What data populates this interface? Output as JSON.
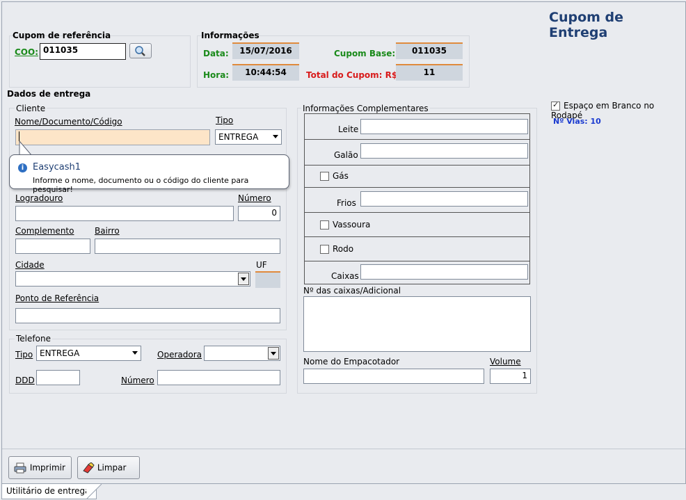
{
  "title": "Cupom de Entrega",
  "cupom_ref": {
    "heading": "Cupom de referência",
    "coo_label": "COO:",
    "coo_value": "011035"
  },
  "info": {
    "heading": "Informações",
    "data_label": "Data:",
    "data_value": "15/07/2016",
    "hora_label": "Hora:",
    "hora_value": "10:44:54",
    "cupom_base_label": "Cupom Base:",
    "cupom_base_value": "011035",
    "total_label": "Total do Cupom: R$",
    "total_value": "11"
  },
  "dados": {
    "heading": "Dados de entrega",
    "cliente_heading": "Cliente",
    "nome_label": "Nome/Documento/Código",
    "tipo_label": "Tipo",
    "tipo_value": "ENTREGA",
    "logradouro_label": "Logradouro",
    "numero_label": "Número",
    "numero_value": "0",
    "complemento_label": "Complemento",
    "bairro_label": "Bairro",
    "cidade_label": "Cidade",
    "uf_label": "UF",
    "ponto_label": "Ponto de Referência"
  },
  "tooltip": {
    "title": "Easycash1",
    "text": "Informe o nome, documento ou o código do cliente para pesquisar!"
  },
  "telefone": {
    "heading": "Telefone",
    "tipo_label": "Tipo",
    "tipo_value": "ENTREGA",
    "operadora_label": "Operadora",
    "ddd_label": "DDD",
    "numero_label": "Número"
  },
  "complementares": {
    "heading": "Informações Complementares",
    "leite": "Leite",
    "galao": "Galão",
    "gas": "Gás",
    "frios": "Frios",
    "vassoura": "Vassoura",
    "rodo": "Rodo",
    "caixas": "Caixas",
    "nr_caixas_label": "Nº das caixas/Adicional",
    "empacotador_label": "Nome do Empacotador",
    "volume_label": "Volume",
    "volume_value": "1"
  },
  "options": {
    "espaco_label": "Espaço em Branco no Rodapé",
    "vias_label": "Nº Vias: 10"
  },
  "buttons": {
    "imprimir": "Imprimir",
    "limpar": "Limpar"
  },
  "tab_label": "Utilitário de entrega"
}
